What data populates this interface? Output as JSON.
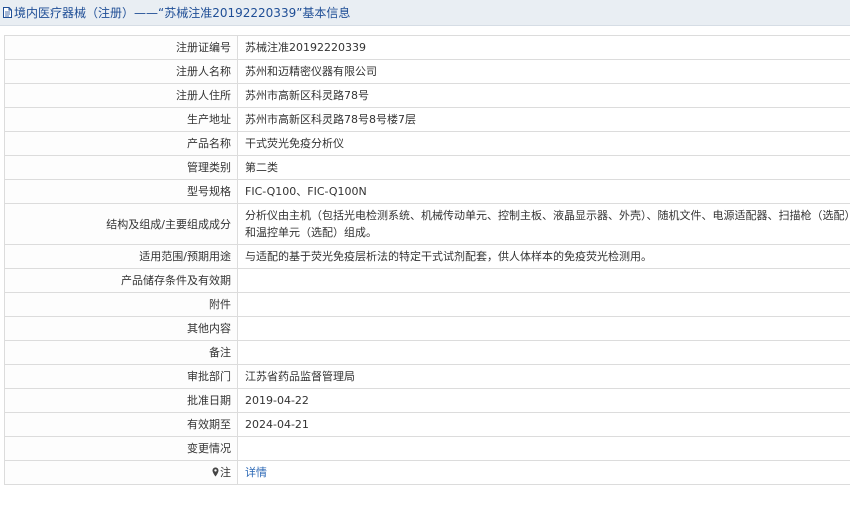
{
  "header": {
    "category": "境内医疗器械（注册）",
    "separator": " —— ",
    "record_title": "“苏械注准20192220339”基本信息",
    "accent_color": "#1f4e96"
  },
  "fields": [
    {
      "label": "注册证编号",
      "value": "苏械注准20192220339"
    },
    {
      "label": "注册人名称",
      "value": "苏州和迈精密仪器有限公司"
    },
    {
      "label": "注册人住所",
      "value": "苏州市高新区科灵路78号"
    },
    {
      "label": "生产地址",
      "value": "苏州市高新区科灵路78号8号楼7层"
    },
    {
      "label": "产品名称",
      "value": "干式荧光免疫分析仪"
    },
    {
      "label": "管理类别",
      "value": "第二类"
    },
    {
      "label": "型号规格",
      "value": "FIC-Q100、FIC-Q100N"
    },
    {
      "label": "结构及组成/主要组成成分",
      "value": "分析仪由主机（包括光电检测系统、机械传动单元、控制主板、液晶显示器、外壳）、随机文件、电源适配器、扫描枪（选配）和温控单元（选配）组成。"
    },
    {
      "label": "适用范围/预期用途",
      "value": "与适配的基于荧光免疫层析法的特定干式试剂配套，供人体样本的免疫荧光检测用。"
    },
    {
      "label": "产品储存条件及有效期",
      "value": ""
    },
    {
      "label": "附件",
      "value": ""
    },
    {
      "label": "其他内容",
      "value": ""
    },
    {
      "label": "备注",
      "value": ""
    },
    {
      "label": "审批部门",
      "value": "江苏省药品监督管理局"
    },
    {
      "label": "批准日期",
      "value": "2019-04-22"
    },
    {
      "label": "有效期至",
      "value": "2024-04-21"
    },
    {
      "label": "变更情况",
      "value": ""
    }
  ],
  "note": {
    "icon": "pin-icon",
    "label": "注",
    "link_text": "详情",
    "link_color": "#2a67b5"
  }
}
